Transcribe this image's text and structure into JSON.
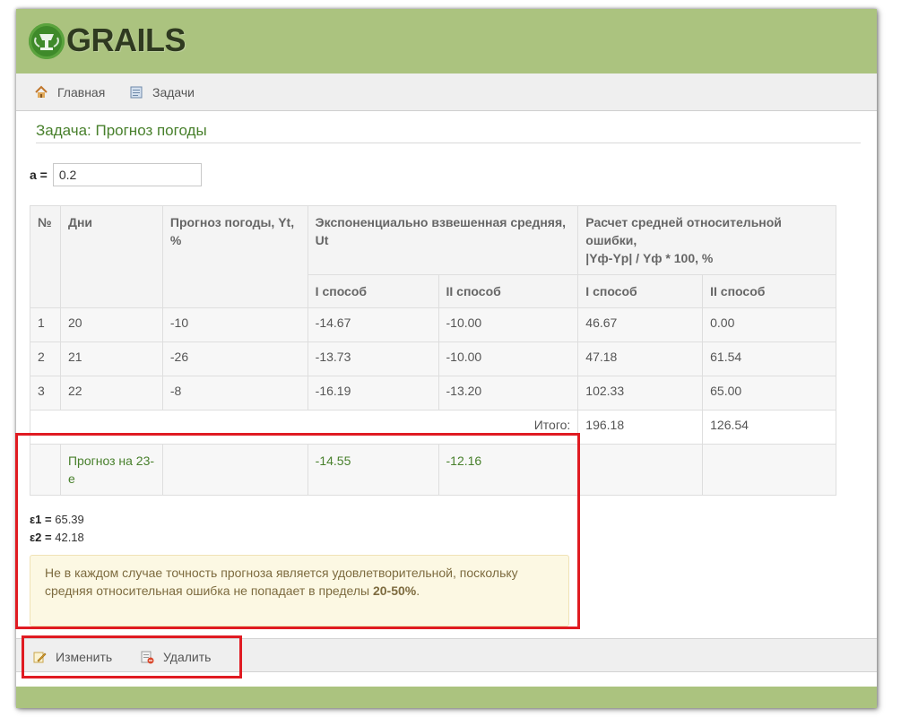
{
  "brand": {
    "logo_text": "GRAILS",
    "header_color": "#abc37f",
    "logo_color": "#3f8a2a"
  },
  "nav": {
    "items": [
      {
        "label": "Главная",
        "icon": "home-icon"
      },
      {
        "label": "Задачи",
        "icon": "list-icon"
      }
    ]
  },
  "page": {
    "title": "Задача: Прогноз погоды"
  },
  "alpha": {
    "label": "a =",
    "value": "0.2"
  },
  "table": {
    "headers": {
      "num": "№",
      "days": "Дни",
      "forecast": "Прогноз погоды, Yt, %",
      "ewma": "Экспоненциально взвешенная средняя, Ut",
      "error_line1": "Расчет средней относительной ошибки,",
      "error_line2": "|Yф-Yр| / Yф * 100, %",
      "method1": "I способ",
      "method2": "II способ"
    },
    "rows": [
      {
        "num": "1",
        "day": "20",
        "yt": "-10",
        "u1": "-14.67",
        "u2": "-10.00",
        "e1": "46.67",
        "e2": "0.00"
      },
      {
        "num": "2",
        "day": "21",
        "yt": "-26",
        "u1": "-13.73",
        "u2": "-10.00",
        "e1": "47.18",
        "e2": "61.54"
      },
      {
        "num": "3",
        "day": "22",
        "yt": "-8",
        "u1": "-16.19",
        "u2": "-13.20",
        "e1": "102.33",
        "e2": "65.00"
      }
    ],
    "total": {
      "label": "Итого:",
      "e1": "196.18",
      "e2": "126.54"
    },
    "forecast_row": {
      "label": "Прогноз на 23-е",
      "u1": "-14.55",
      "u2": "-12.16"
    }
  },
  "epsilon": {
    "e1_label": "ε1 =",
    "e1_value": "65.39",
    "e2_label": "ε2 =",
    "e2_value": "42.18"
  },
  "alert": {
    "text": "Не в каждом случае точность прогноза является удовлетворительной, поскольку средняя относительная ошибка не попадает в пределы ",
    "range": "20-50%",
    "end": "."
  },
  "actions": {
    "edit_label": "Изменить",
    "delete_label": "Удалить"
  },
  "colors": {
    "accent_green": "#48802c",
    "highlight_red": "#e01b22",
    "alert_bg": "#fcf8e3"
  }
}
